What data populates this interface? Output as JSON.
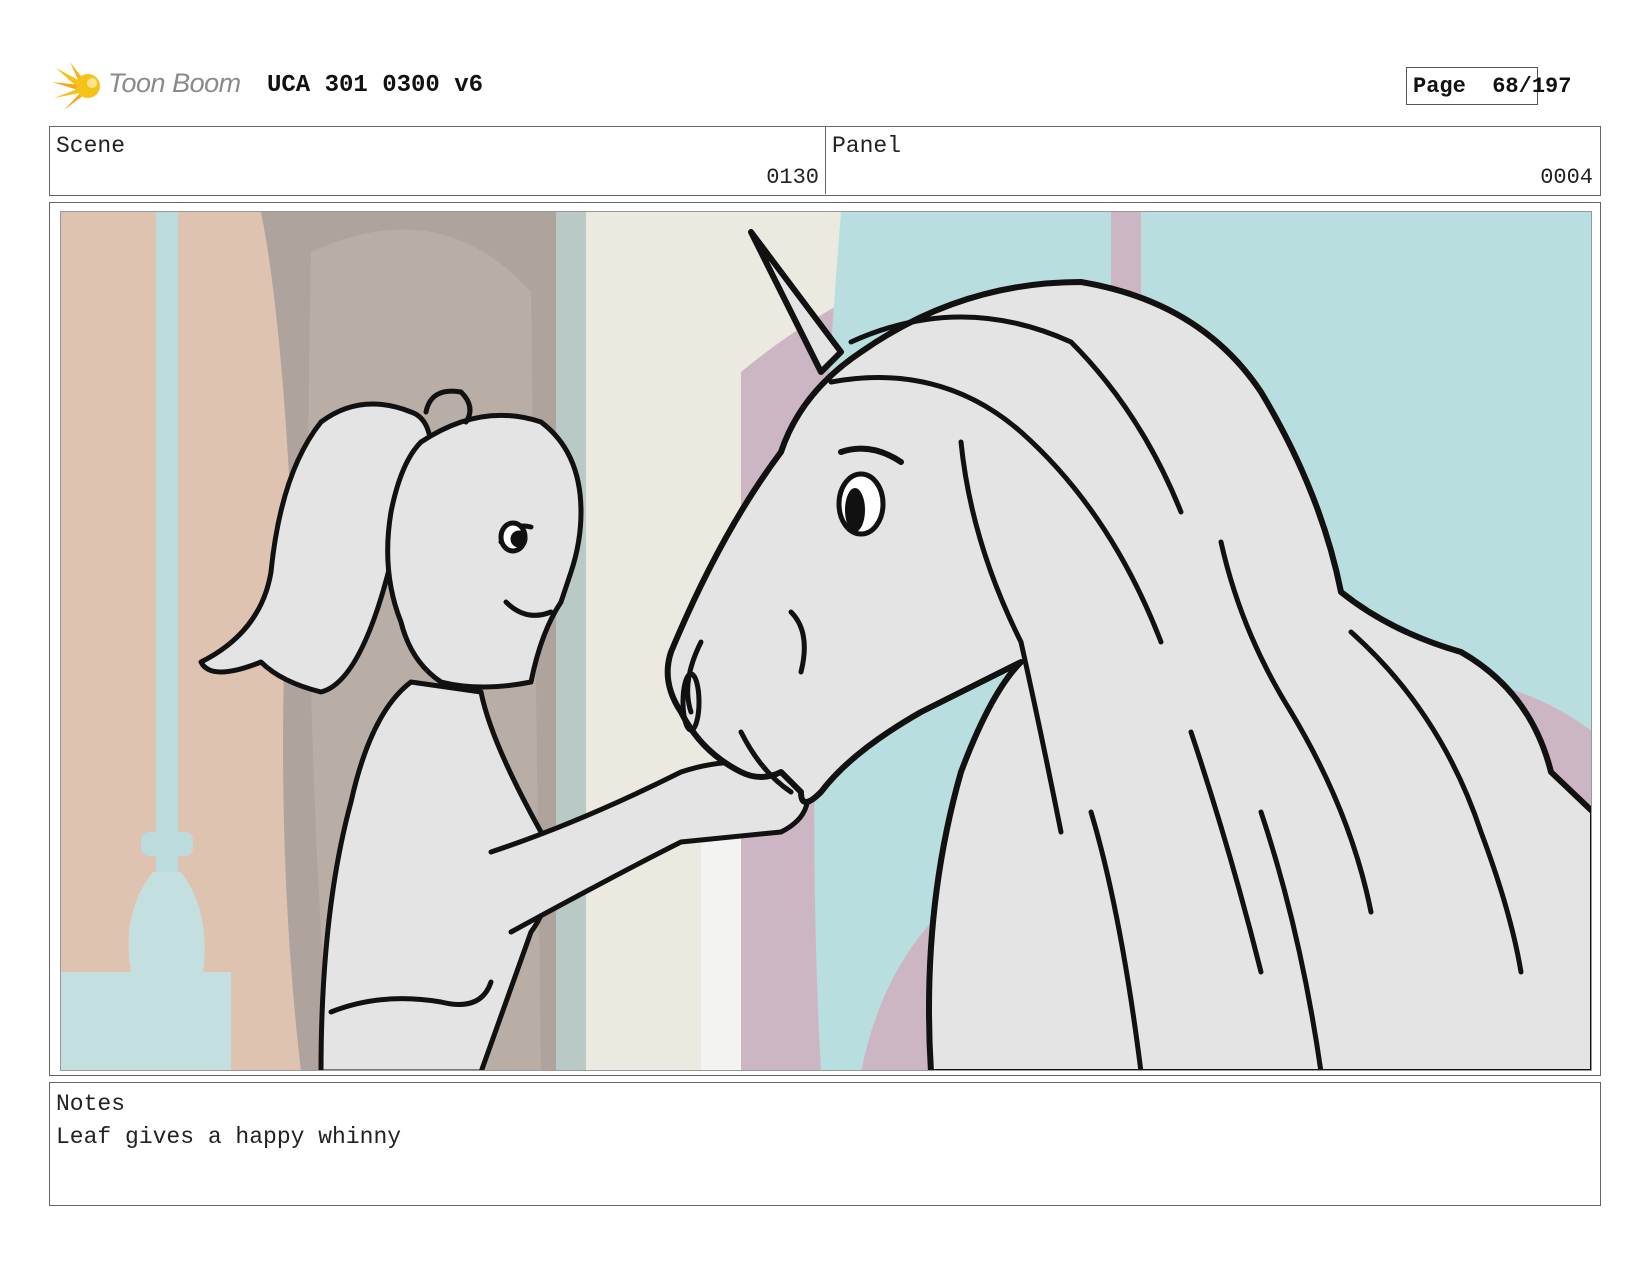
{
  "header": {
    "logo_text": "Toon Boom",
    "doc_title": "UCA 301 0300 v6",
    "page_label": "Page",
    "page_value": "68/197"
  },
  "scene": {
    "label": "Scene",
    "value": "0130"
  },
  "panel": {
    "label": "Panel",
    "value": "0004"
  },
  "notes": {
    "label": "Notes",
    "text": "Leaf gives a happy whinny"
  },
  "colors": {
    "logo_yellow": "#f6c21a",
    "pillar_blue": "#bcdbdc",
    "wall_peach": "#dfc3b1",
    "door_grey": "#aea49d",
    "cream": "#ece9e1",
    "lilac": "#cdb6c4",
    "sky_teal": "#b8dee0",
    "sketch_fill": "#e4e4e4"
  }
}
